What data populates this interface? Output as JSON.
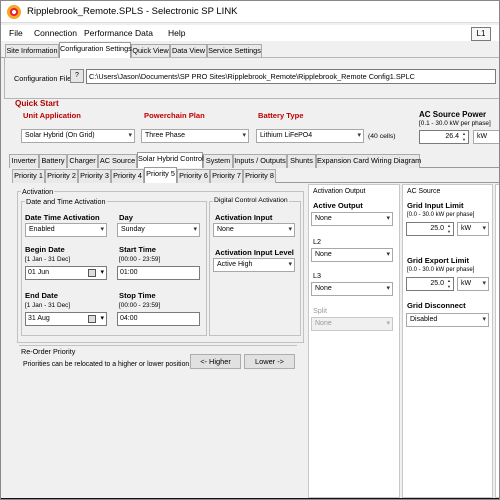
{
  "window": {
    "title": "Ripplebrook_Remote.SPLS - Selectronic SP LINK",
    "badge": "L1"
  },
  "menu": [
    "File",
    "Connection",
    "Performance Data",
    "Help"
  ],
  "main_tabs": [
    "Site Information",
    "Configuration Settings",
    "Quick View",
    "Data View",
    "Service Settings"
  ],
  "config_file": {
    "label": "Configuration File",
    "browse_label": "?",
    "path": "C:\\Users\\Jason\\Documents\\SP PRO Sites\\Ripplebrook_Remote\\Ripplebrook_Remote Config1.SPLC"
  },
  "quick_start": {
    "title": "Quick Start",
    "unit_application": {
      "label": "Unit Application",
      "value": "Solar Hybrid (On Grid)"
    },
    "powerchain_plan": {
      "label": "Powerchain Plan",
      "value": "Three Phase"
    },
    "battery_type": {
      "label": "Battery Type",
      "value": "Lithium LiFePO4",
      "cells": "(40 cells)"
    },
    "ac_source_power": {
      "label": "AC Source Power",
      "range": "[0.1 - 30.0 kW per phase]",
      "value": "26.4",
      "unit": "kW"
    }
  },
  "sub_tabs": [
    "Inverter",
    "Battery",
    "Charger",
    "AC Source",
    "Solar Hybrid Control",
    "System",
    "Inputs / Outputs",
    "Shunts",
    "Expansion Card Wiring Diagram"
  ],
  "priority_tabs": [
    "Priority 1",
    "Priority 2",
    "Priority 3",
    "Priority 4",
    "Priority 5",
    "Priority 6",
    "Priority 7",
    "Priority 8"
  ],
  "activation": {
    "title": "Activation",
    "date_time": {
      "title": "Date and Time Activation",
      "dta_label": "Date Time Activation",
      "dta_value": "Enabled",
      "day_label": "Day",
      "day_value": "Sunday",
      "begin_date_label": "Begin Date",
      "begin_date_range": "[1 Jan - 31 Dec]",
      "begin_date_value": "01 Jun",
      "start_time_label": "Start Time",
      "start_time_range": "[00:00 - 23:59]",
      "start_time_value": "01:00",
      "end_date_label": "End Date",
      "end_date_range": "[1 Jan - 31 Dec]",
      "end_date_value": "31 Aug",
      "stop_time_label": "Stop Time",
      "stop_time_range": "[00:00 - 23:59]",
      "stop_time_value": "04:00"
    },
    "digital": {
      "title": "Digital Control Activation",
      "input_label": "Activation Input",
      "input_value": "None",
      "level_label": "Activation Input Level",
      "level_value": "Active High"
    }
  },
  "activation_output": {
    "title": "Activation Output",
    "active_output_label": "Active Output",
    "active_output_value": "None",
    "l2_label": "L2",
    "l2_value": "None",
    "l3_label": "L3",
    "l3_value": "None",
    "split_label": "Split",
    "split_value": "None"
  },
  "ac_source": {
    "title": "AC Source",
    "grid_input_label": "Grid Input Limit",
    "grid_input_range": "[0.0 - 30.0 kW per phase]",
    "grid_input_value": "25.0",
    "grid_input_unit": "kW",
    "grid_export_label": "Grid Export Limit",
    "grid_export_range": "[0.0 - 30.0 kW per phase]",
    "grid_export_value": "25.0",
    "grid_export_unit": "kW",
    "disconnect_label": "Grid Disconnect",
    "disconnect_value": "Disabled"
  },
  "reorder": {
    "title": "Re-Order Priority",
    "text": "Priorities can be relocated to a higher or lower position.",
    "higher_label": "<- Higher",
    "lower_label": "Lower ->"
  }
}
